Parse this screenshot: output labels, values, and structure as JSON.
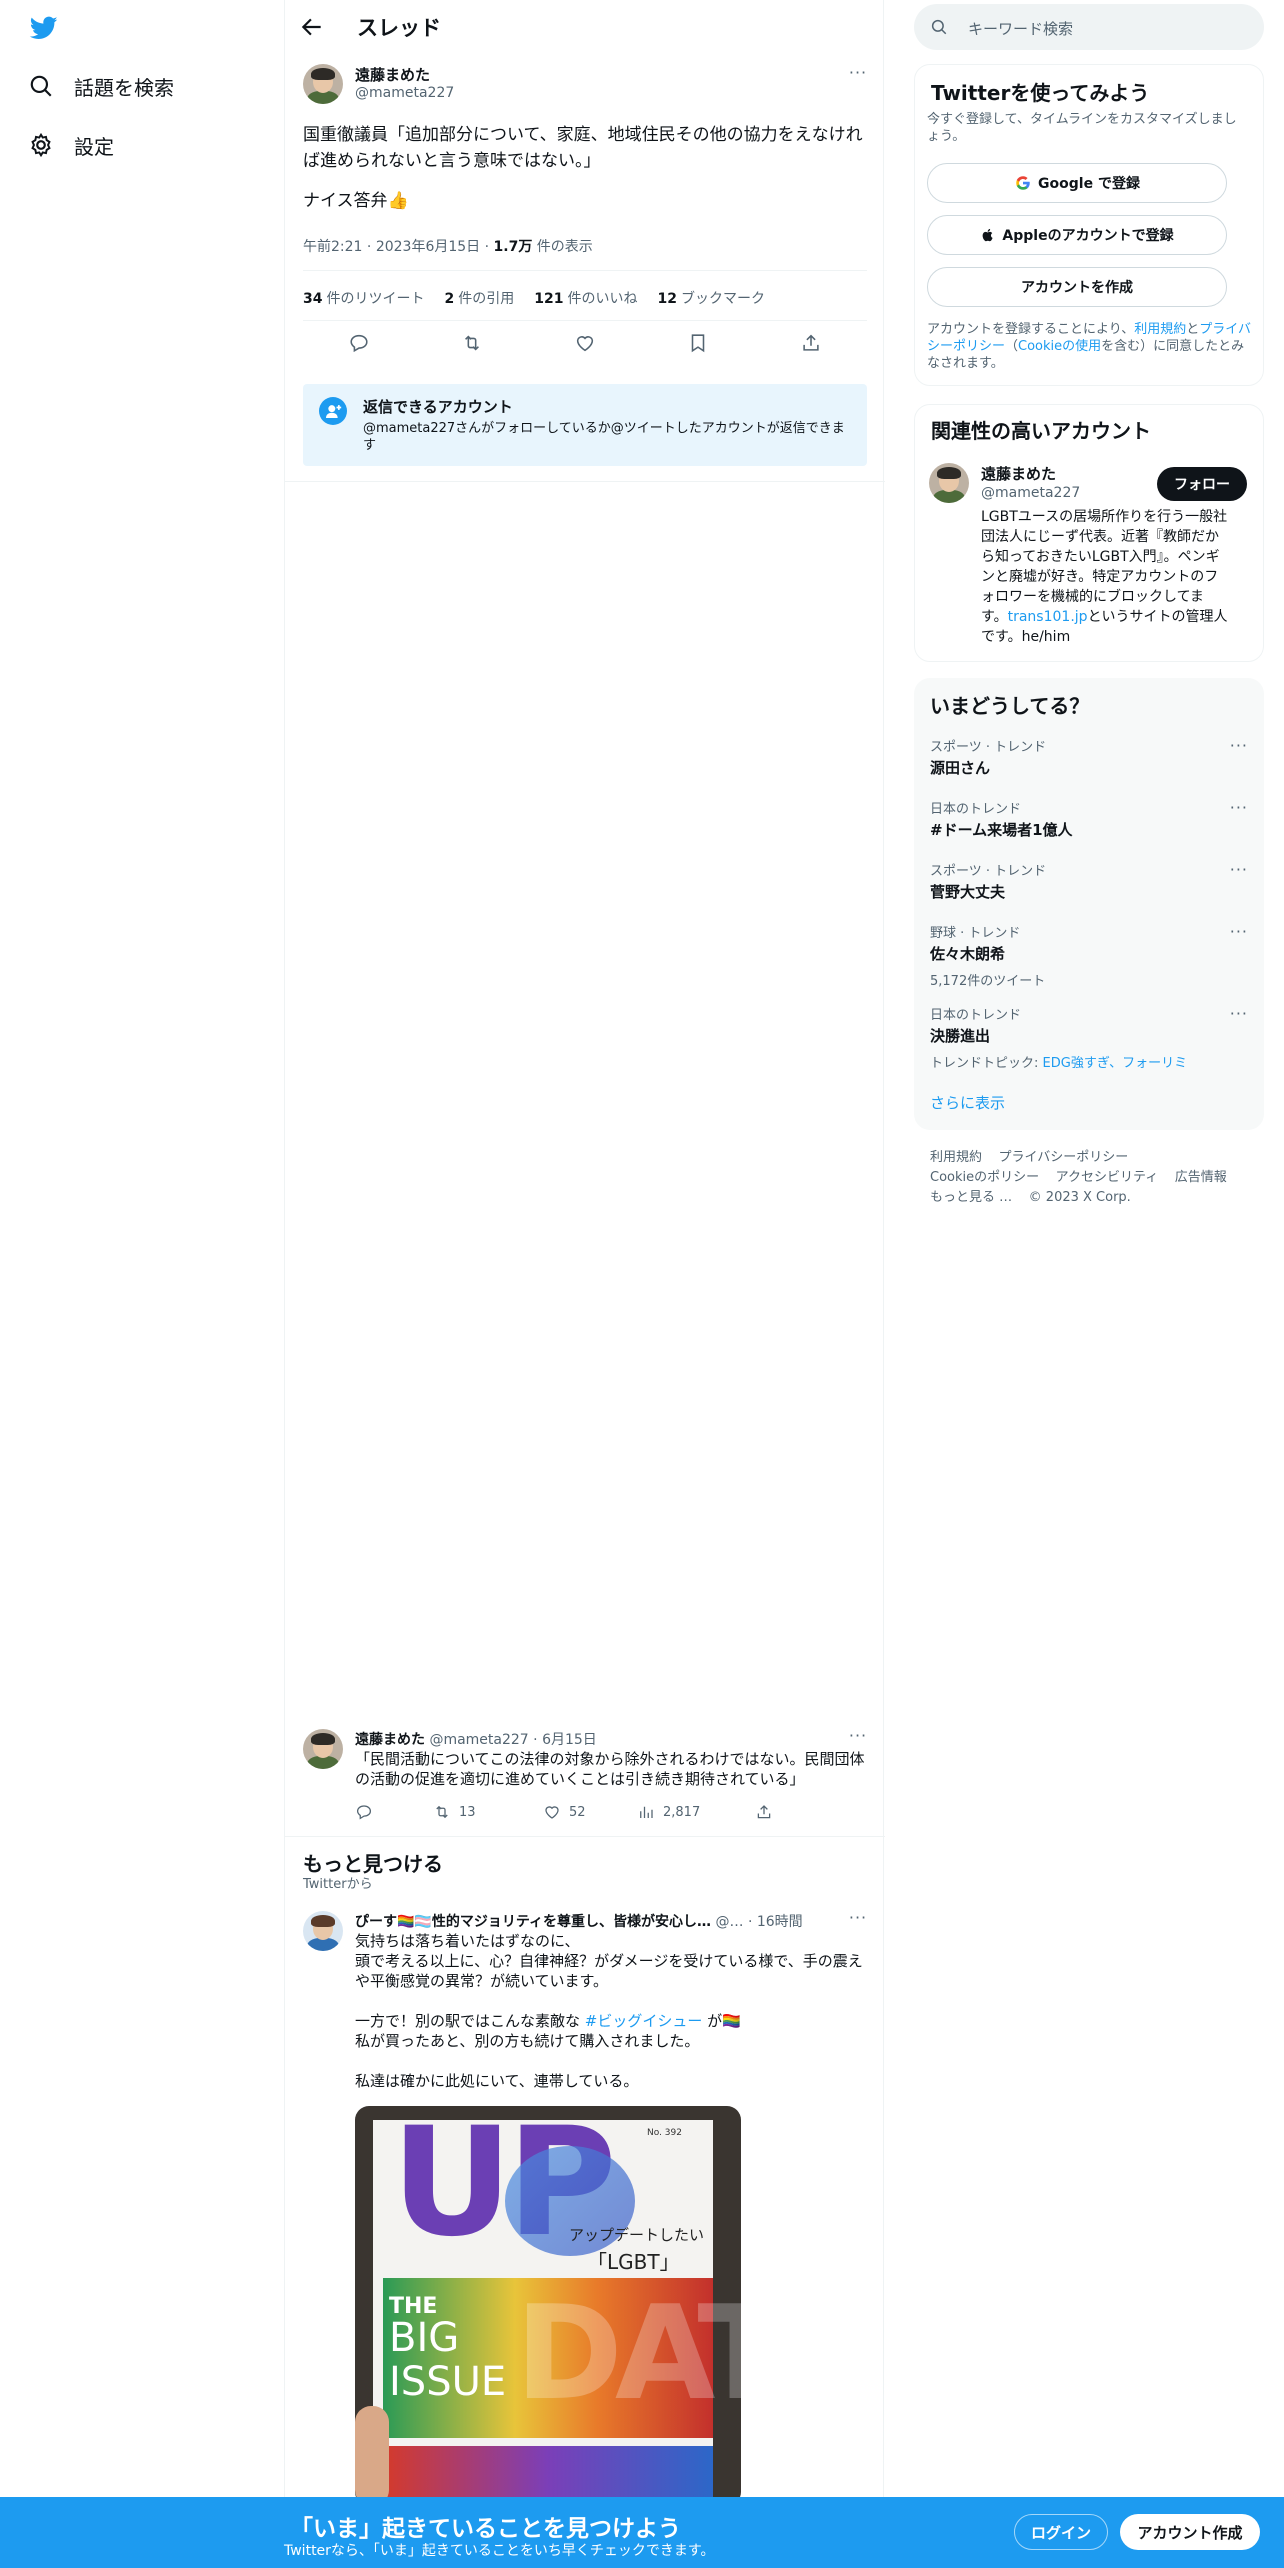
{
  "nav": {
    "explore_label": "話題を検索",
    "settings_label": "設定"
  },
  "header": {
    "title": "スレッド"
  },
  "tweet": {
    "author_name": "遠藤まめた",
    "author_handle": "@mameta227",
    "text_line1": "国重徹議員「追加部分について、家庭、地域住民その他の協力をえなけれ",
    "text_line2": "ば進められないと言う意味ではない。」",
    "text_line3": "ナイス答弁👍",
    "time": "午前2:21",
    "date": "2023年6月15日",
    "views_count": "1.7万",
    "views_label": "件の表示",
    "retweets_count": "34",
    "retweets_label": "件のリツイート",
    "quotes_count": "2",
    "quotes_label": "件の引用",
    "likes_count": "121",
    "likes_label": "件のいいね",
    "bookmarks_count": "12",
    "bookmarks_label": "ブックマーク"
  },
  "reply_restriction": {
    "title": "返信できるアカウント",
    "desc": "@mameta227さんがフォローしているか@ツイートしたアカウントが返信できます"
  },
  "parent_tweet": {
    "author_name": "遠藤まめた",
    "author_handle": "@mameta227",
    "date": "6月15日",
    "text": "「民間活動についてこの法律の対象から除外されるわけではない。民間団体の活動の促進を適切に進めていくことは引き続き期待されている」",
    "retweets": "13",
    "likes": "52",
    "views": "2,817"
  },
  "discover": {
    "title": "もっと見つける",
    "subtitle": "Twitterから"
  },
  "discover_tweet": {
    "author_name": "ぴーす🏳️‍🌈🏳️‍⚧️性的マジョリティを尊重し、皆様が安心し…",
    "author_handle": "@…",
    "time": "16時間",
    "line1": "気持ちは落ち着いたはずなのに、",
    "line2": "頭で考える以上に、心？自律神経？がダメージを受けている様で、手の震え",
    "line3": "や平衡感覚の異常？が続いています。",
    "line4a": "一方で！別の駅ではこんな素敵な",
    "line4_hashtag": "#ビッグイシュー",
    "line4b": "が🏳️‍🌈",
    "line5": "私が買ったあと、別の方も続けて購入されました。",
    "line6": "私達は確かに此処にいて、連帯している。",
    "image": {
      "no": "No. 392",
      "heading": "アップデートしたい",
      "heading2": "「LGBT」",
      "the": "THE",
      "big": "BIG",
      "issue": "ISSUE",
      "up": "UP",
      "date": "DATE"
    }
  },
  "search": {
    "placeholder": "キーワード検索"
  },
  "signup_card": {
    "title": "Twitterを使ってみよう",
    "desc": "今すぐ登録して、タイムラインをカスタマイズしましょう。",
    "google": "Google で登録",
    "apple": "Appleのアカウントで登録",
    "create": "アカウントを作成",
    "legal_a": "アカウントを登録することにより、",
    "legal_terms": "利用規約",
    "legal_b": "と",
    "legal_privacy": "プライバシーポリシー",
    "legal_c": "（",
    "legal_cookie": "Cookieの使用",
    "legal_d": "を含む）に同意したとみなされます。"
  },
  "related": {
    "title": "関連性の高いアカウント",
    "name": "遠藤まめた",
    "handle": "@mameta227",
    "follow": "フォロー",
    "bio1": "LGBTユースの居場所作りを行う一般社",
    "bio2": "団法人にじーず代表。近著『教師だか",
    "bio3": "ら知っておきたいLGBT入門』。ペンギ",
    "bio4": "ンと廃墟が好き。特定アカウントのフ",
    "bio5": "ォロワーを機械的にブロックしてま",
    "bio6a": "す。",
    "bio6_link": "trans101.jp",
    "bio6b": "というサイトの管理人",
    "bio7": "です。he/him"
  },
  "trends": {
    "title": "いまどうしてる？",
    "items": [
      {
        "category": "スポーツ · トレンド",
        "name": "源田さん",
        "sub": ""
      },
      {
        "category": "日本のトレンド",
        "name": "#ドーム来場者1億人",
        "sub": ""
      },
      {
        "category": "スポーツ · トレンド",
        "name": "菅野大丈夫",
        "sub": ""
      },
      {
        "category": "野球 · トレンド",
        "name": "佐々木朗希",
        "sub": "5,172件のツイート"
      },
      {
        "category": "日本のトレンド",
        "name": "決勝進出",
        "sub": "トレンドトピック: "
      }
    ],
    "last_topic_link": "EDG強すぎ、フォーリミ",
    "show_more": "さらに表示"
  },
  "footer": {
    "terms": "利用規約",
    "privacy": "プライバシーポリシー",
    "cookie": "Cookieのポリシー",
    "accessibility": "アクセシビリティ",
    "ads": "広告情報",
    "more": "もっと見る …",
    "copyright": "© 2023 X Corp."
  },
  "bottom_bar": {
    "headline": "「いま」起きていることを見つけよう",
    "sub": "Twitterなら、「いま」起きていることをいち早くチェックできます。",
    "login": "ログイン",
    "signup": "アカウント作成"
  },
  "colors": {
    "accent": "#1d9bf0",
    "text": "#0f1419",
    "secondary": "#536471"
  }
}
